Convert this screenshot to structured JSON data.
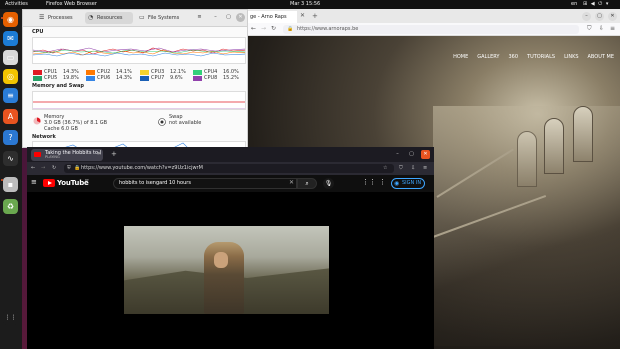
{
  "topbar": {
    "activities": "Activities",
    "app_name": "Firefox Web Browser",
    "clock": "Mar 3  15:56",
    "lang": "en"
  },
  "dock": {
    "items": [
      {
        "name": "firefox-icon",
        "color": "#e66000",
        "glyph": "◉"
      },
      {
        "name": "thunderbird-icon",
        "color": "#1c7cd5",
        "glyph": "✉"
      },
      {
        "name": "files-icon",
        "color": "#d9d9d9",
        "glyph": "▭"
      },
      {
        "name": "rhythmbox-icon",
        "color": "#f2c400",
        "glyph": "◎"
      },
      {
        "name": "writer-icon",
        "color": "#2a7cd6",
        "glyph": "≡"
      },
      {
        "name": "software-icon",
        "color": "#e95420",
        "glyph": "A"
      },
      {
        "name": "help-icon",
        "color": "#2b78d2",
        "glyph": "?"
      },
      {
        "name": "system-monitor-icon",
        "color": "#2e2e2e",
        "glyph": "∿"
      },
      {
        "name": "disk-icon",
        "color": "#bdbdbd",
        "glyph": "▪"
      },
      {
        "name": "trash-icon",
        "color": "#6aa84f",
        "glyph": "♻"
      },
      {
        "name": "show-apps-icon",
        "color": "#1c1c1c",
        "glyph": "⋮⋮"
      }
    ]
  },
  "sysmon": {
    "tabs": [
      "Processes",
      "Resources",
      "File Systems"
    ],
    "cpu_title": "CPU",
    "cpus": [
      {
        "label": "CPU1",
        "value": "14.3%",
        "color": "#e01b24"
      },
      {
        "label": "CPU2",
        "value": "14.1%",
        "color": "#ff7800"
      },
      {
        "label": "CPU3",
        "value": "12.1%",
        "color": "#f6d32d"
      },
      {
        "label": "CPU4",
        "value": "16.0%",
        "color": "#33d17a"
      },
      {
        "label": "CPU5",
        "value": "19.8%",
        "color": "#26a269"
      },
      {
        "label": "CPU6",
        "value": "14.3%",
        "color": "#3584e4"
      },
      {
        "label": "CPU7",
        "value": "9.6%",
        "color": "#1a5fb4"
      },
      {
        "label": "CPU8",
        "value": "15.2%",
        "color": "#9141ac"
      }
    ],
    "mem_title": "Memory and Swap",
    "memory_label": "Memory",
    "memory_value": "3.0 GB (36.7%) of 8.1 GB",
    "cache_value": "Cache 6.0 GB",
    "swap_label": "Swap",
    "swap_value": "not available",
    "network_title": "Network"
  },
  "right_browser": {
    "tab_title": "ge - Arno Raps",
    "url": "https://www.arnoraps.be",
    "nav": [
      "HOME",
      "GALLERY",
      "360",
      "TUTORIALS",
      "LINKS",
      "ABOUT ME"
    ]
  },
  "yt_browser": {
    "tab_title": "Taking the Hobbits to I",
    "tab_sub": "PLAYING",
    "url": "https://www.youtube.com/watch?v=z9Uz1icjwrM",
    "brand": "YouTube",
    "brand_cc": "BE",
    "search_value": "hobbits to isengard 10 hours",
    "sign_in": "SIGN IN"
  }
}
